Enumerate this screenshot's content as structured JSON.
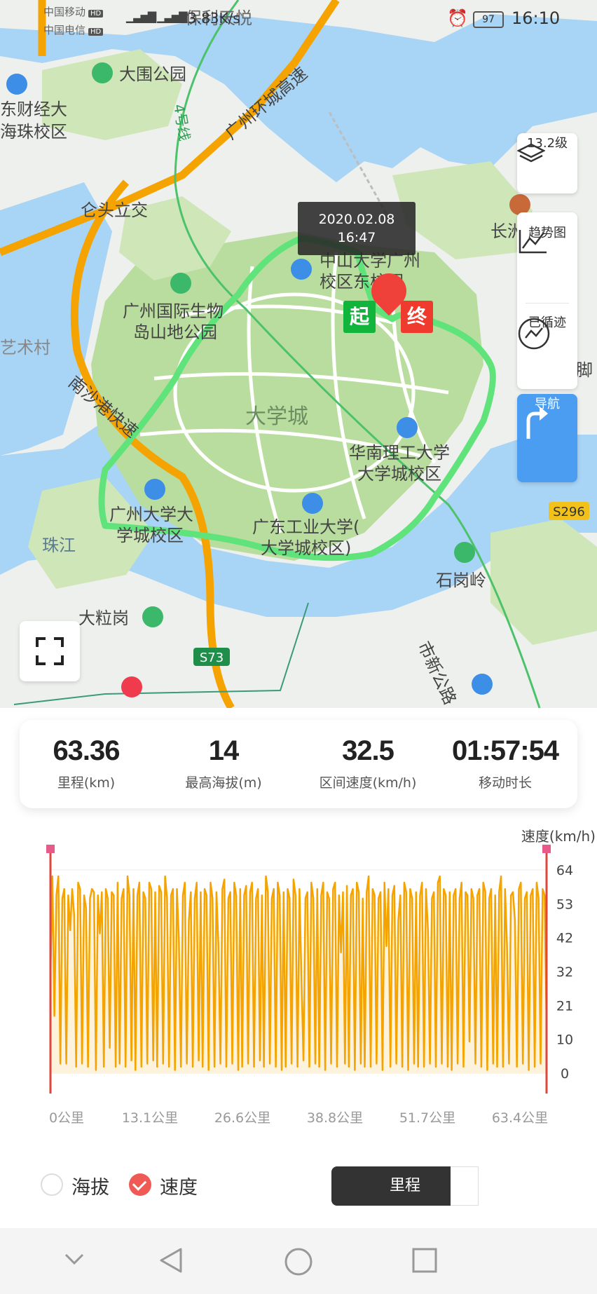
{
  "status_bar": {
    "carrier1": "中国移动",
    "carrier2": "中国电信",
    "hd": "HD",
    "net_speed": "3.83K/s",
    "battery": "97",
    "time": "16:10"
  },
  "map": {
    "labels": [
      {
        "text": "大围公园"
      },
      {
        "text": "东财经大"
      },
      {
        "text": "海珠校区"
      },
      {
        "text": "广州环城高速"
      },
      {
        "text": "4号线"
      },
      {
        "text": "仑头立交"
      },
      {
        "text": "广州国际生物"
      },
      {
        "text": "岛山地公园"
      },
      {
        "text": "艺术村"
      },
      {
        "text": "南沙港快速"
      },
      {
        "text": "大学城"
      },
      {
        "text": "中山大学广州"
      },
      {
        "text": "校区东校园"
      },
      {
        "text": "华南理工大学"
      },
      {
        "text": "大学城校区"
      },
      {
        "text": "广州大学大"
      },
      {
        "text": "学城校区"
      },
      {
        "text": "广东工业大学("
      },
      {
        "text": "大学城校区)"
      },
      {
        "text": "珠江"
      },
      {
        "text": "大粒岗"
      },
      {
        "text": "石岗岭"
      },
      {
        "text": "市新公路"
      },
      {
        "text": "长洲"
      },
      {
        "text": "脚"
      },
      {
        "text": "保利天悦"
      }
    ],
    "road_badges": {
      "s73": "S73",
      "s296": "S296"
    },
    "tooltip": {
      "date": "2020.02.08",
      "time": "16:47"
    },
    "start_marker": "起",
    "end_marker": "终"
  },
  "toolbar": {
    "zoom_label": "13.2级",
    "trend_label": "趋势图",
    "loop_label": "已循迹",
    "nav_label": "导航"
  },
  "stats": [
    {
      "value": "63.36",
      "label": "里程(km)"
    },
    {
      "value": "14",
      "label": "最高海拔(m)"
    },
    {
      "value": "32.5",
      "label": "区间速度(km/h)"
    },
    {
      "value": "01:57:54",
      "label": "移动时长"
    }
  ],
  "chart_data": {
    "type": "area",
    "ylabel": "速度(km/h)",
    "yticks": [
      "64",
      "53",
      "42",
      "32",
      "21",
      "10",
      "0"
    ],
    "ylim": [
      0,
      64
    ],
    "xticks": [
      "0公里",
      "13.1公里",
      "26.6公里",
      "38.8公里",
      "51.7公里",
      "63.4公里"
    ],
    "xlim": [
      0,
      63.4
    ],
    "grid": true,
    "color": "#f5a300",
    "fill": "#fdf3dc",
    "series": [
      {
        "values": [
          30,
          62,
          18,
          56,
          62,
          3,
          55,
          58,
          3,
          56,
          45,
          58,
          50,
          2,
          60,
          58,
          3,
          56,
          52,
          2,
          55,
          58,
          57,
          1,
          56,
          44,
          57,
          2,
          58,
          55,
          8,
          57,
          56,
          2,
          60,
          3,
          55,
          58,
          2,
          62,
          56,
          4,
          58,
          1,
          56,
          60,
          2,
          57,
          55,
          3,
          60,
          58,
          4,
          57,
          2,
          59,
          57,
          3,
          62,
          55,
          2,
          56,
          58,
          1,
          58,
          42,
          2,
          56,
          60,
          3,
          48,
          57,
          2,
          55,
          60,
          4,
          57,
          2,
          58,
          56,
          1,
          60,
          55,
          2,
          57,
          40,
          3,
          58,
          61,
          2,
          55,
          57,
          3,
          60,
          56,
          1,
          58,
          2,
          56,
          59,
          3,
          57,
          60,
          2,
          55,
          58,
          4,
          56,
          2,
          62,
          57,
          3,
          55,
          58,
          2,
          60,
          56,
          1,
          57,
          2,
          58,
          55,
          3,
          61,
          56,
          2,
          58,
          30,
          4,
          55,
          57,
          2,
          60,
          55,
          3,
          58,
          2,
          56,
          60,
          1,
          57,
          55,
          3,
          58,
          60,
          2,
          56,
          38,
          57,
          3,
          59,
          2,
          56,
          58,
          1,
          60,
          57,
          3,
          55,
          2,
          57,
          62,
          2,
          58,
          56,
          3,
          55,
          57,
          1,
          60,
          40,
          58,
          2,
          56,
          59,
          3,
          48,
          56,
          2,
          60,
          57,
          1,
          58,
          55,
          3,
          57,
          2,
          56,
          60,
          2,
          58,
          45,
          3,
          55,
          57,
          2,
          60,
          62,
          3,
          58,
          56,
          2,
          57,
          1,
          56,
          58,
          3,
          55,
          60,
          2,
          57,
          56,
          10,
          58,
          55,
          3,
          56,
          58,
          2,
          60,
          57,
          1,
          55,
          58,
          3,
          56,
          2,
          57,
          62,
          2,
          58,
          40,
          3,
          56,
          57,
          48,
          2,
          58,
          60,
          3,
          55,
          57,
          1,
          56,
          58,
          2,
          60,
          55,
          3,
          58,
          56,
          15
        ]
      }
    ]
  },
  "toggles": {
    "altitude_label": "海拔",
    "speed_label": "速度",
    "segment_label": "里程"
  }
}
